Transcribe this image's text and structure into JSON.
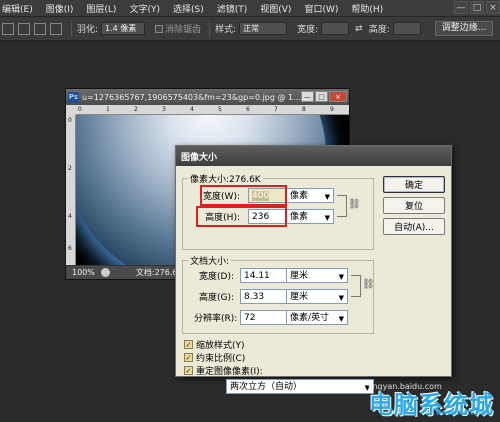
{
  "menubar": {
    "items": [
      "编辑(E)",
      "图像(I)",
      "图层(L)",
      "文字(Y)",
      "选择(S)",
      "滤镜(T)",
      "视图(V)",
      "窗口(W)",
      "帮助(H)"
    ],
    "win_controls": [
      "—",
      "□",
      "×"
    ]
  },
  "options_bar": {
    "feather_label": "羽化:",
    "feather_value": "1.4 像素",
    "antialias_label": "消除锯齿",
    "style_label": "样式:",
    "style_value": "正常",
    "width_label": "宽度:",
    "height_label": "高度:",
    "refine_edge_button": "调整边缘..."
  },
  "document": {
    "title": "u=1276365767,1906575403&fm=23&gp=0.jpg @ 1...",
    "app_icon": "Ps",
    "ruler_top": [
      "0",
      "1",
      "2",
      "3",
      "4",
      "5",
      "6",
      "7",
      "8",
      "9"
    ],
    "ruler_left": [
      "0",
      "2",
      "4",
      "6"
    ],
    "zoom": "100%",
    "doc_info": "文档:276.6"
  },
  "dialog": {
    "title": "图像大小",
    "pixel_dim_label": "像素大小:276.6K",
    "width_label": "宽度(W):",
    "width_value": "400",
    "width_unit": "像素",
    "height_label": "高度(H):",
    "height_value": "236",
    "height_unit": "像素",
    "doc_size_label": "文档大小:",
    "doc_width_label": "宽度(D):",
    "doc_width_value": "14.11",
    "doc_width_unit": "厘米",
    "doc_height_label": "高度(G):",
    "doc_height_value": "8.33",
    "doc_height_unit": "厘米",
    "resolution_label": "分辨率(R):",
    "resolution_value": "72",
    "resolution_unit": "像素/英寸",
    "scale_styles": "缩放样式(Y)",
    "constrain": "约束比例(C)",
    "resample": "重定图像像素(I):",
    "resample_method": "两次立方（自动）",
    "ok_button": "确定",
    "reset_button": "复位",
    "auto_button": "自动(A)...",
    "chain_icon": "chain-link-icon"
  },
  "watermark": {
    "main": "电脑系统城",
    "sub": "www.dnxtc.net",
    "baidu": "jingyan.baidu.com"
  },
  "colors": {
    "highlight_box": "#e02020",
    "watermark": "#2aa9e6"
  }
}
